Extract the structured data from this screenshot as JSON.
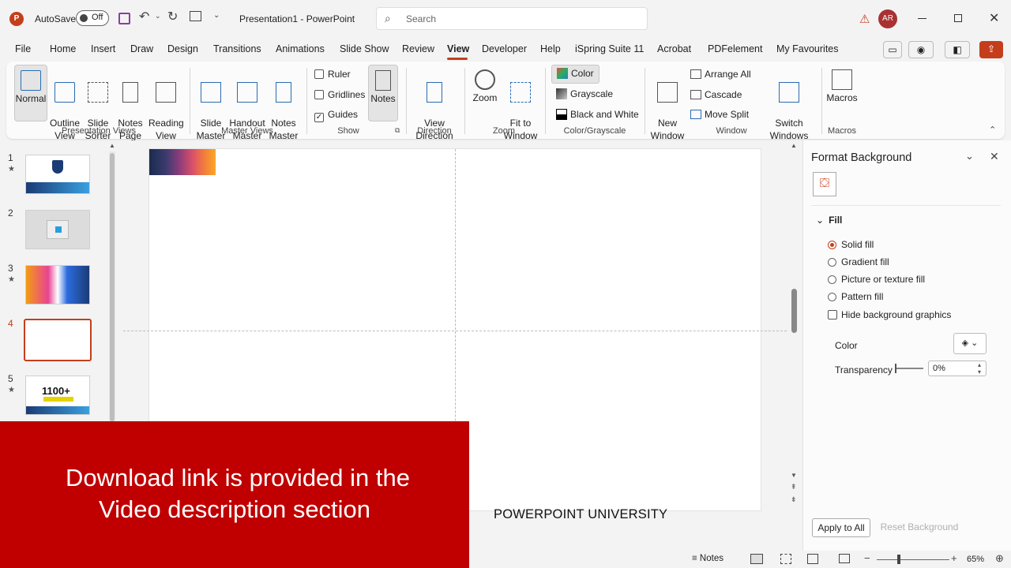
{
  "titlebar": {
    "autosave_label": "AutoSave",
    "autosave_state": "Off",
    "doc_title": "Presentation1 - PowerPoint",
    "search_placeholder": "Search",
    "user_initials": "AR"
  },
  "tabs": [
    "File",
    "Home",
    "Insert",
    "Draw",
    "Design",
    "Transitions",
    "Animations",
    "Slide Show",
    "Review",
    "View",
    "Developer",
    "Help",
    "iSpring Suite 11",
    "Acrobat",
    "PDFelement",
    "My Favourites"
  ],
  "active_tab": "View",
  "ribbon": {
    "presentation_views": {
      "label": "Presentation Views",
      "normal": "Normal",
      "outline": "Outline\nView",
      "sorter": "Slide\nSorter",
      "notes_page": "Notes\nPage",
      "reading": "Reading\nView"
    },
    "master_views": {
      "label": "Master Views",
      "slide_master": "Slide\nMaster",
      "handout_master": "Handout\nMaster",
      "notes_master": "Notes\nMaster"
    },
    "show": {
      "label": "Show",
      "ruler": "Ruler",
      "gridlines": "Gridlines",
      "guides": "Guides",
      "notes": "Notes"
    },
    "direction": {
      "label": "Direction",
      "view_direction": "View\nDirection"
    },
    "zoom": {
      "label": "Zoom",
      "zoom": "Zoom",
      "fit": "Fit to\nWindow"
    },
    "color": {
      "label": "Color/Grayscale",
      "color": "Color",
      "grayscale": "Grayscale",
      "bw": "Black and White"
    },
    "window": {
      "label": "Window",
      "new_window": "New\nWindow",
      "arrange_all": "Arrange All",
      "cascade": "Cascade",
      "move_split": "Move Split",
      "switch_windows": "Switch\nWindows"
    },
    "macros": {
      "label": "Macros",
      "macros": "Macros"
    }
  },
  "slides": [
    {
      "num": "1",
      "star": "★"
    },
    {
      "num": "2",
      "star": ""
    },
    {
      "num": "3",
      "star": "★"
    },
    {
      "num": "4",
      "star": ""
    },
    {
      "num": "5",
      "star": "★",
      "headline": "1100+"
    }
  ],
  "format_pane": {
    "title": "Format Background",
    "fill_section": "Fill",
    "options": [
      "Solid fill",
      "Gradient fill",
      "Picture or texture fill",
      "Pattern fill"
    ],
    "hide_bg": "Hide background graphics",
    "color_label": "Color",
    "transparency_label": "Transparency",
    "transparency_value": "0%",
    "apply_all": "Apply to All",
    "reset_bg": "Reset Background"
  },
  "banner": {
    "line1": "Download link is provided in the",
    "line2": "Video description section"
  },
  "watermark": "POWERPOINT UNIVERSITY",
  "statusbar": {
    "notes": "Notes",
    "zoom": "65%"
  }
}
